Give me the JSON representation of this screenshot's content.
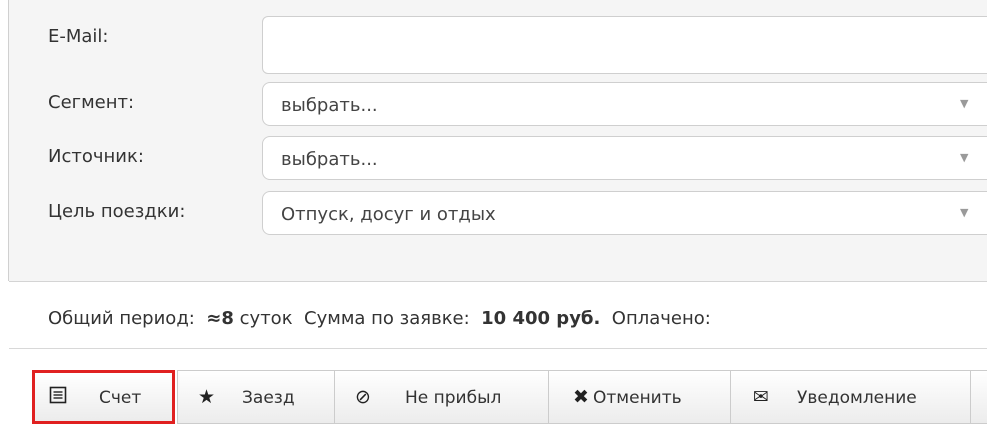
{
  "form": {
    "email": {
      "label": "E-Mail:",
      "value": ""
    },
    "segment": {
      "label": "Сегмент:",
      "value": "выбрать..."
    },
    "source": {
      "label": "Источник:",
      "value": "выбрать..."
    },
    "purpose": {
      "label": "Цель поездки:",
      "value": "Отпуск, досуг и отдых"
    }
  },
  "summary": {
    "period_label": "Общий период:",
    "period_value": "≈8",
    "period_unit": "суток",
    "total_label": "Сумма по заявке:",
    "total_value": "10 400 руб.",
    "paid_label": "Оплачено:"
  },
  "toolbar": {
    "invoice": {
      "label": "Счет",
      "icon": "invoice-list-icon"
    },
    "checkin": {
      "label": "Заезд",
      "icon": "star-icon"
    },
    "noshow": {
      "label": "Не прибыл",
      "icon": "no-entry-icon"
    },
    "cancel": {
      "label": "Отменить",
      "icon": "x-mark-icon"
    },
    "notify": {
      "label": "Уведомление",
      "icon": "envelope-icon"
    }
  },
  "colors": {
    "highlight": "#e02020"
  }
}
